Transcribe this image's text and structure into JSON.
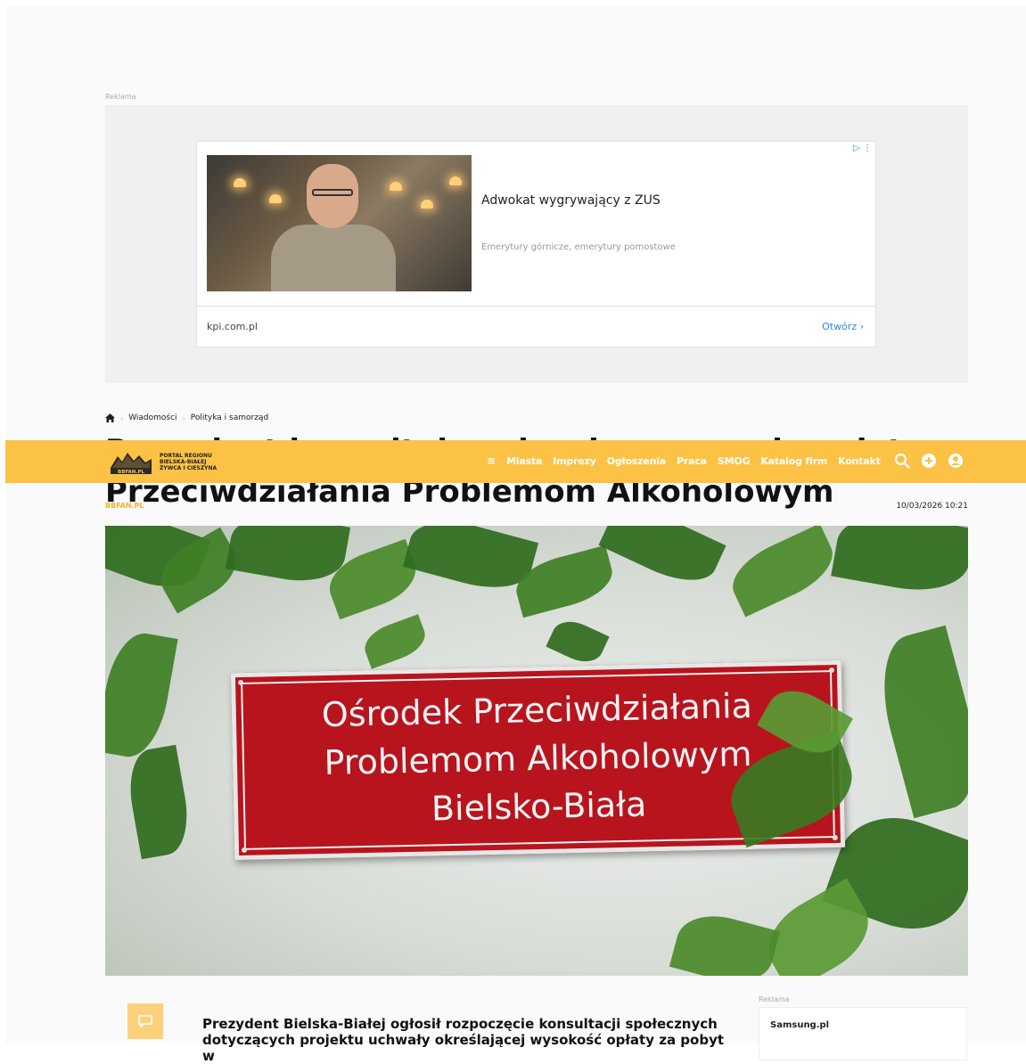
{
  "top_ad": {
    "label": "Reklama",
    "title": "Adwokat wygrywający z ZUS",
    "description": "Emerytury górnicze, emerytury pomostowe",
    "domain": "kpi.com.pl",
    "open_label": "Otwórz",
    "adchoices_icon": "adchoices-icon"
  },
  "breadcrumb": {
    "home_icon": "home-icon",
    "items": [
      "Wiadomości",
      "Polityka i samorząd"
    ]
  },
  "article": {
    "title_line1": "Prezydent konsultuje uchwałę w sprawie opłat za pobyt w Ośrodku",
    "title_line2": "Przeciwdziałania Problemom Alkoholowym",
    "source": "BBFAN.PL",
    "date": "10/03/2026 10:21",
    "lead": "Prezydent Bielska-Białej ogłosił rozpoczęcie konsultacji społecznych dotyczących projektu uchwały określającej wysokość opłaty za pobyt w"
  },
  "hero_sign": {
    "line1": "Ośrodek Przeciwdziałania",
    "line2": "Problemom Alkoholowym",
    "line3": "Bielsko-Biała"
  },
  "navbar": {
    "logo_line1": "PORTAL REGIONU",
    "logo_line2": "BIELSKA-BIAŁEJ",
    "logo_line3": "ŻYWCA I CIESZYNA",
    "logo_badge": "BBFAN.PL",
    "menu_icon": "≡",
    "links": [
      "Miasta",
      "Imprezy",
      "Ogłoszenia",
      "Praca",
      "SMOG",
      "Katalog firm",
      "Kontakt"
    ],
    "color": "#fbc245"
  },
  "sidebar": {
    "ad_label": "Reklama",
    "card_title": "Samsung.pl"
  }
}
